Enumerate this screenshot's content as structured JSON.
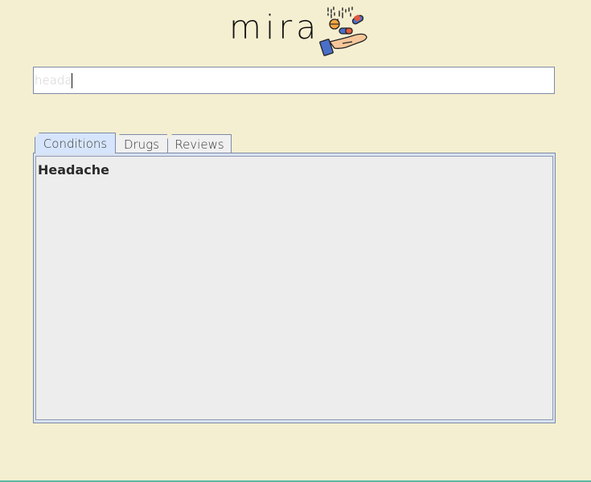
{
  "app": {
    "logo_text": "mira"
  },
  "search": {
    "value": "heada",
    "placeholder": ""
  },
  "tabs": [
    {
      "label": "Conditions",
      "active": true
    },
    {
      "label": "Drugs",
      "active": false
    },
    {
      "label": "Reviews",
      "active": false
    }
  ],
  "results": [
    {
      "label": "Headache"
    }
  ],
  "colors": {
    "background": "#f5efd1",
    "active_tab": "#d6e5fb",
    "panel_bg": "#ededed",
    "border": "#7d8aa5"
  },
  "icons": {
    "logo_graphic": "hand-with-pills-icon"
  }
}
